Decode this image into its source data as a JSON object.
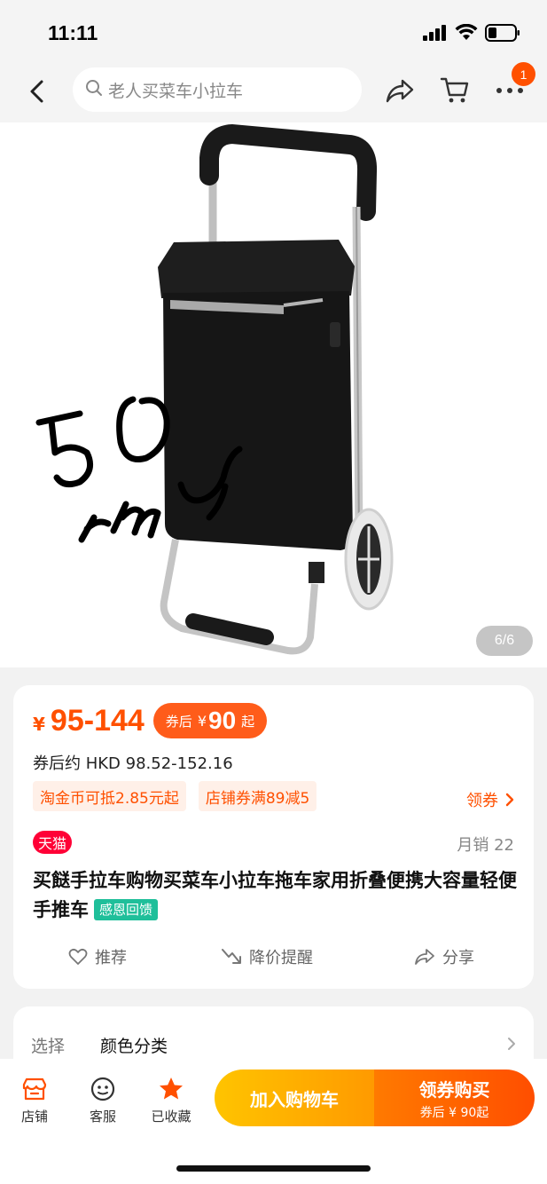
{
  "status_bar": {
    "time": "11:11"
  },
  "nav": {
    "search_text": "老人买菜车小拉车",
    "cart_badge": "1"
  },
  "hero": {
    "page_indicator": "6/6",
    "handwritten_text": "50 rmb"
  },
  "price": {
    "currency_symbol": "¥",
    "range": "95-144",
    "coupon_label": "券后",
    "coupon_symbol": "¥",
    "coupon_price": "90",
    "coupon_suffix": "起",
    "hkd_line": "券后约 HKD 98.52-152.16",
    "promos": [
      "淘金币可抵2.85元起",
      "店铺券满89减5"
    ],
    "get_coupon": "领券"
  },
  "product": {
    "store_badge": "天猫",
    "monthly_sales": "月销 22",
    "title": "买餸手拉车购物买菜车小拉车拖车家用折叠便携大容量轻便手推车",
    "gratitude_tag": "感恩回馈"
  },
  "actions": {
    "recommend": "推荐",
    "price_alert": "降价提醒",
    "share": "分享"
  },
  "selection": {
    "label": "选择",
    "value": "颜色分类"
  },
  "bottom_bar": {
    "store": "店铺",
    "service": "客服",
    "favorited": "已收藏",
    "add_to_cart": "加入购物车",
    "buy_with_coupon": "领券购买",
    "buy_sub": "券后 ¥ 90起"
  },
  "colors": {
    "accent": "#ff5000",
    "tmall": "#ff0036",
    "gratitude": "#1fbf9a"
  }
}
